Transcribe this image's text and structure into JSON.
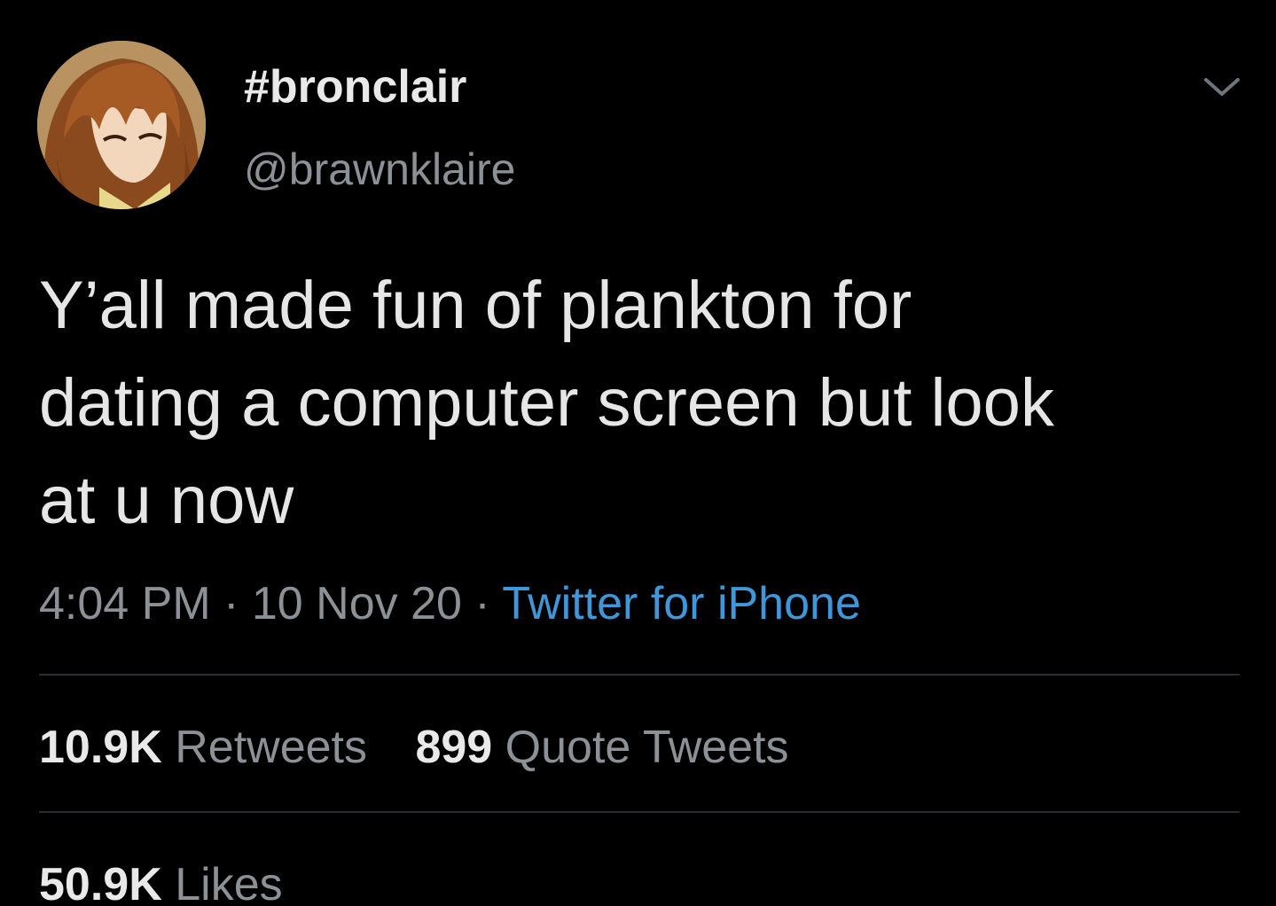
{
  "tweet": {
    "author": {
      "display_name": "#bronclair",
      "handle": "@brawnklaire",
      "avatar_icon": "anime-character-avatar"
    },
    "menu_icon": "chevron-down-icon",
    "text_lines": [
      "Y’all made fun of plankton for",
      "dating a computer screen but look",
      "at u now"
    ],
    "time": "4:04 PM",
    "separator": "·",
    "date": "10 Nov 20",
    "source": "Twitter for iPhone",
    "stats": {
      "retweets_count": "10.9K",
      "retweets_label": "Retweets",
      "quotes_count": "899",
      "quotes_label": "Quote Tweets",
      "likes_count": "50.9K",
      "likes_label": "Likes"
    }
  },
  "colors": {
    "background": "#000000",
    "text_primary": "#e7e9ea",
    "text_secondary": "#8b9196",
    "link": "#3f97d8",
    "divider": "#2a2d30"
  }
}
